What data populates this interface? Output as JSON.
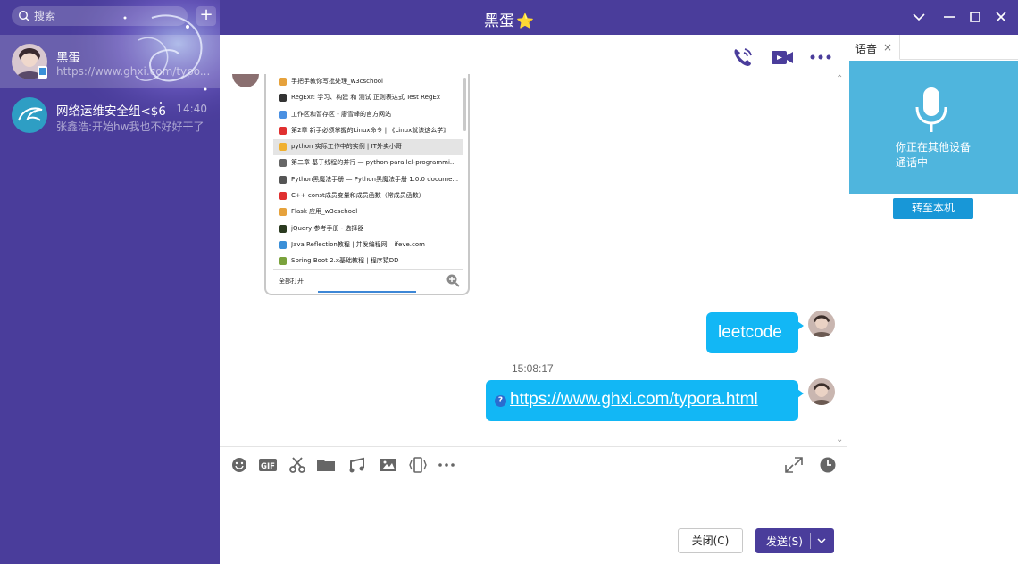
{
  "window": {
    "title": "黑蛋",
    "title_badge": "⭐"
  },
  "sidebar": {
    "search_placeholder": "搜索",
    "add_label": "+",
    "contacts": [
      {
        "name": "黑蛋",
        "preview": "https://www.ghxi.com/typo...",
        "time": "",
        "active": true
      },
      {
        "name": "网络运维安全组<$6",
        "preview": "张鑫浩:开始hw我也不好好干了",
        "time": "14:40",
        "active": false
      }
    ]
  },
  "screenshot_list": {
    "items": [
      {
        "text": "手把手教你写批处理_w3cschool",
        "color": "#e6a23c"
      },
      {
        "text": "RegExr: 学习、构建 和 测试 正则表达式 Test RegEx",
        "color": "#333333"
      },
      {
        "text": "工作区和暂存区 - 廖雪峰的官方网站",
        "color": "#4a90e2"
      },
      {
        "text": "第2章 新手必须掌握的Linux命令 | 《Linux就该这么学》",
        "color": "#e03030"
      },
      {
        "text": "python 实际工作中的实例 | IT外卖小哥",
        "color": "#f0b030",
        "selected": true
      },
      {
        "text": "第二章 基于线程的并行 — python-parallel-programmi...",
        "color": "#666666"
      },
      {
        "text": "Python黑魔法手册 — Python黑魔法手册 1.0.0 docume...",
        "color": "#555555"
      },
      {
        "text": "C++ const成员变量和成员函数（常成员函数）",
        "color": "#e03030"
      },
      {
        "text": "Flask 应用_w3cschool",
        "color": "#e6a23c"
      },
      {
        "text": "jQuery 参考手册 - 选择器",
        "color": "#2b3a20"
      },
      {
        "text": "Java Reflection教程 | 并发编程网 – ifeve.com",
        "color": "#3a8fd8"
      },
      {
        "text": "Spring Boot 2.x基础教程 | 程序猿DD",
        "color": "#7aa23c"
      }
    ],
    "footer_label": "全部打开"
  },
  "messages": {
    "bubble1": "leetcode",
    "timestamp": "15:08:17",
    "bubble2_link": "https://www.ghxi.com/typora.html"
  },
  "composer": {
    "close_label": "关闭(C)",
    "send_label": "发送(S)"
  },
  "right_panel": {
    "tab_label": "语音",
    "tab_close": "×",
    "status_line1": "你正在其他设备",
    "status_line2": "通话中",
    "transfer_label": "转至本机"
  },
  "colors": {
    "brand": "#4a3d9b",
    "bubble": "#12b7f5",
    "voice_card": "#4fb5dd",
    "transfer": "#1897d7"
  }
}
